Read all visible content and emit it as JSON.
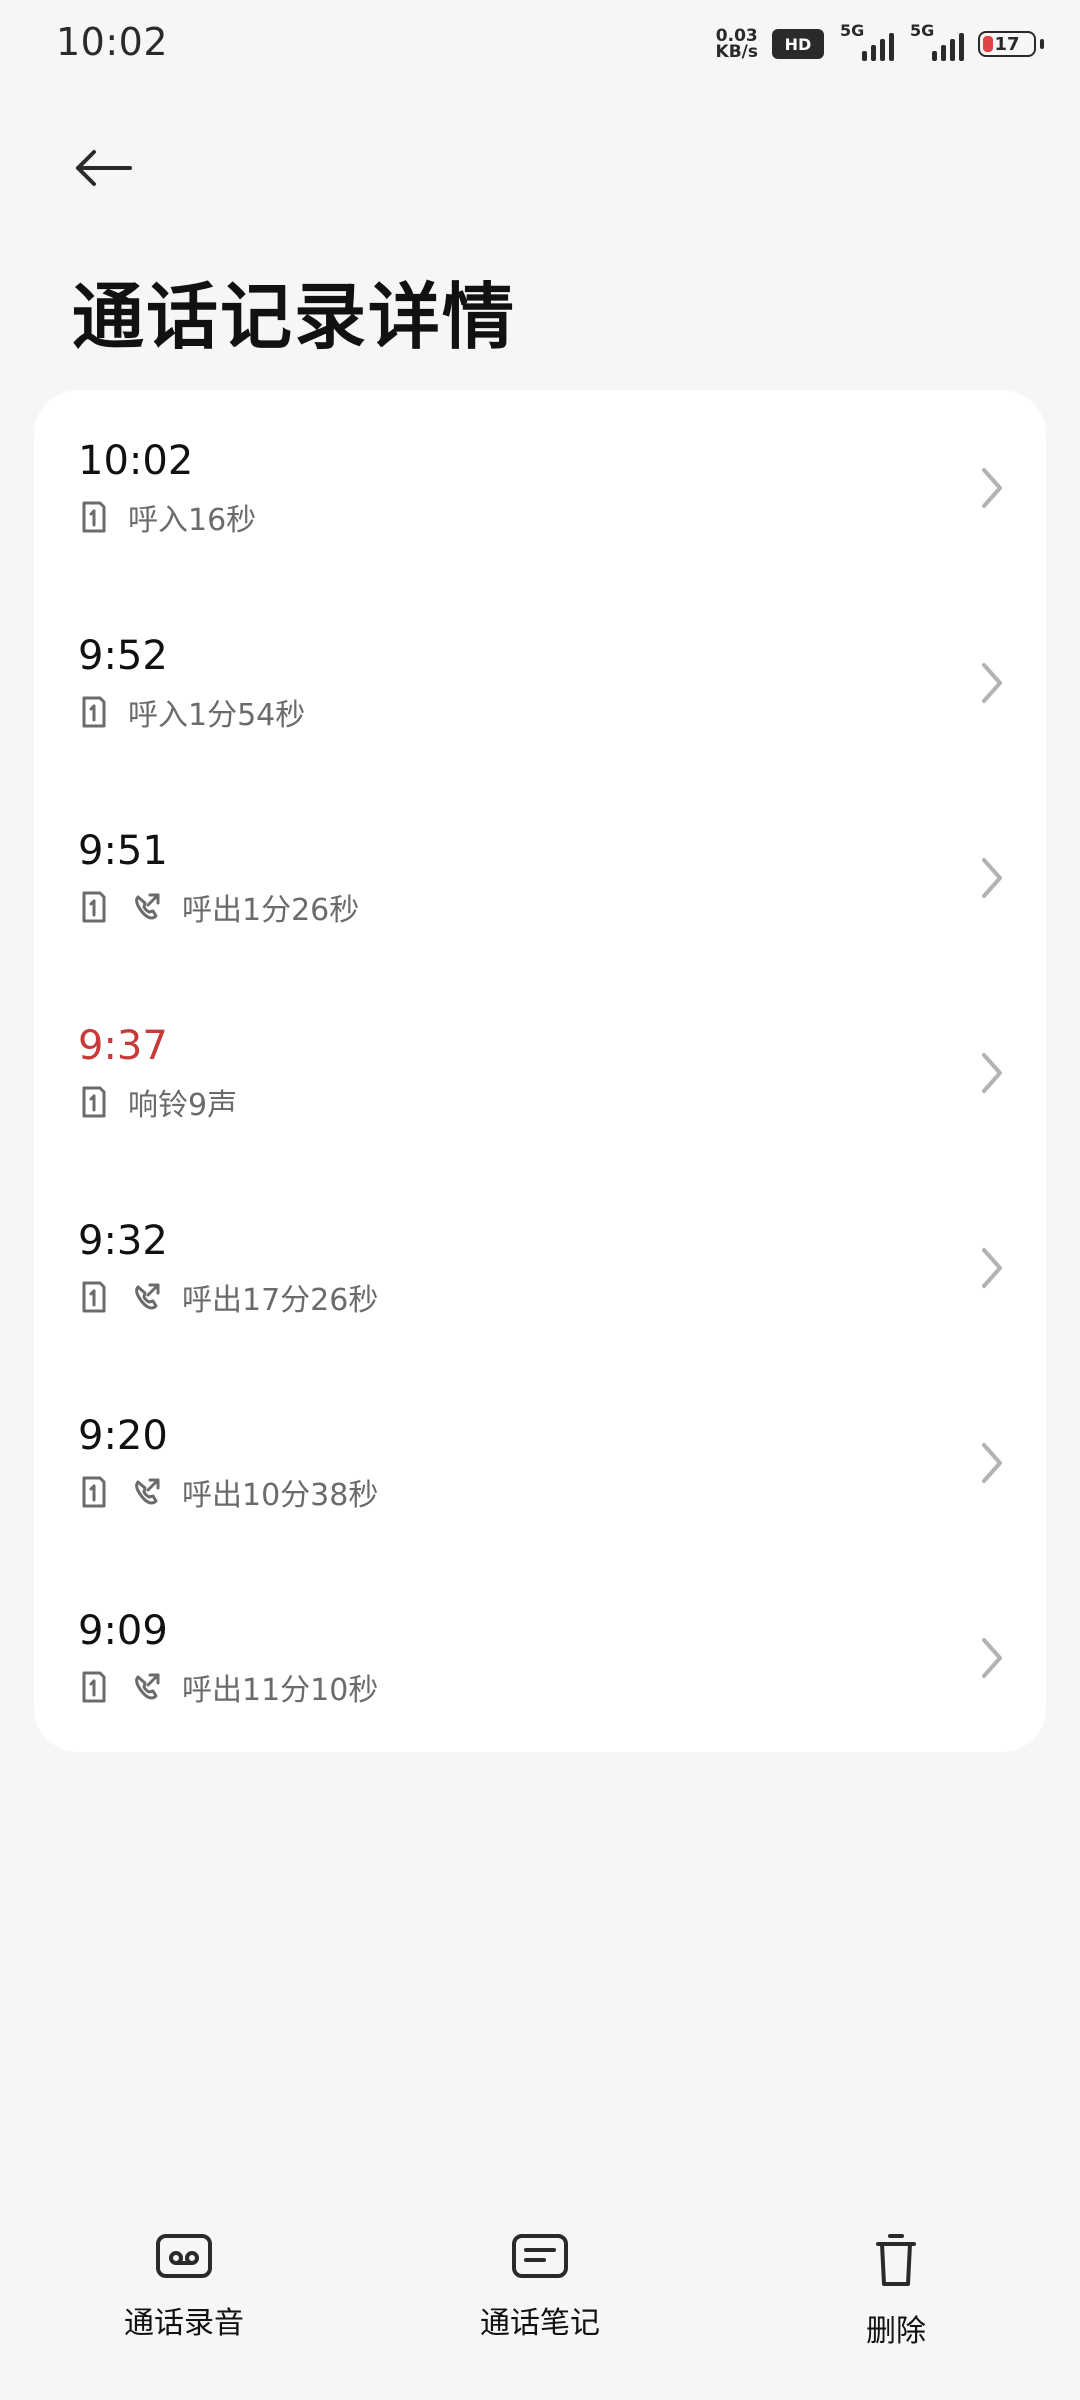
{
  "status_bar": {
    "time": "10:02",
    "net_speed_value": "0.03",
    "net_speed_unit": "KB/s",
    "hd_badge": "HD",
    "signal1_label": "5G",
    "signal2_label": "5G",
    "battery_level": "17"
  },
  "header": {
    "back_icon": "arrow-left-icon",
    "title": "通话记录详情"
  },
  "call_log": [
    {
      "time": "10:02",
      "missed": false,
      "show_call_icon": false,
      "detail": "呼入16秒"
    },
    {
      "time": "9:52",
      "missed": false,
      "show_call_icon": false,
      "detail": "呼入1分54秒"
    },
    {
      "time": "9:51",
      "missed": false,
      "show_call_icon": true,
      "detail": "呼出1分26秒"
    },
    {
      "time": "9:37",
      "missed": true,
      "show_call_icon": false,
      "detail": "响铃9声"
    },
    {
      "time": "9:32",
      "missed": false,
      "show_call_icon": true,
      "detail": "呼出17分26秒"
    },
    {
      "time": "9:20",
      "missed": false,
      "show_call_icon": true,
      "detail": "呼出10分38秒"
    },
    {
      "time": "9:09",
      "missed": false,
      "show_call_icon": true,
      "detail": "呼出11分10秒"
    }
  ],
  "bottom_actions": [
    {
      "label": "通话录音",
      "icon": "cassette-icon"
    },
    {
      "label": "通话笔记",
      "icon": "note-icon"
    },
    {
      "label": "删除",
      "icon": "trash-icon"
    }
  ],
  "colors": {
    "background": "#F6F6F6",
    "card": "#FFFFFF",
    "missed": "#C83A3A",
    "muted_text": "#6B6B6B",
    "chevron": "#B3B3B3"
  }
}
